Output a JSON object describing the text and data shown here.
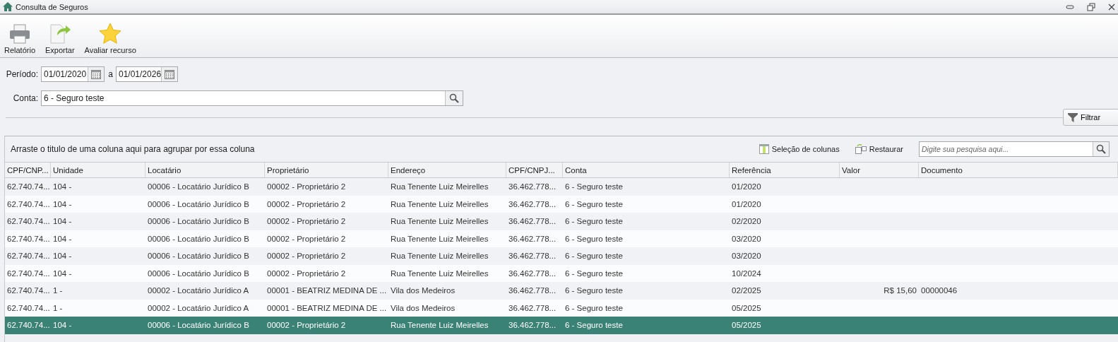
{
  "window": {
    "title": "Consulta de Seguros"
  },
  "toolbar": [
    {
      "label": "Relatório",
      "kind": "printer"
    },
    {
      "label": "Exportar",
      "kind": "export"
    },
    {
      "label": "Avaliar recurso",
      "kind": "star"
    }
  ],
  "filters": {
    "period_label": "Período:",
    "start_date": "01/01/2020",
    "separator": "a",
    "end_date": "01/01/2026",
    "account_label": "Conta:",
    "account": "6 - Seguro teste"
  },
  "filter_button": "Filtrar",
  "grid": {
    "group_hint": "Arraste o titulo de uma coluna aqui para agrupar por essa coluna",
    "column_chooser": "Seleção de colunas",
    "restore": "Restaurar",
    "search": {
      "placeholder": "Digite sua pesquisa aqui..."
    },
    "columns": [
      "CPF/CNP...",
      "Unidade",
      "Locatário",
      "Proprietário",
      "Endereço",
      "CPF/CNPJ...",
      "Conta",
      "Referência",
      "Valor",
      "Documento"
    ],
    "rows": [
      {
        "selected": false,
        "cpf_cnpj": "62.740.74...",
        "unidade": "104 -",
        "locatario": "00006 - Locatário Jurídico B",
        "proprietario": "00002 - Proprietário 2",
        "endereco": "Rua Tenente Luiz Meirelles",
        "cpf_cnpj_proprietario": "36.462.778...",
        "conta": "6 - Seguro teste",
        "referencia": "01/2020"
      },
      {
        "selected": false,
        "cpf_cnpj": "62.740.74...",
        "unidade": "104 -",
        "locatario": "00006 - Locatário Jurídico B",
        "proprietario": "00002 - Proprietário 2",
        "endereco": "Rua Tenente Luiz Meirelles",
        "cpf_cnpj_proprietario": "36.462.778...",
        "conta": "6 - Seguro teste",
        "referencia": "01/2020"
      },
      {
        "selected": false,
        "cpf_cnpj": "62.740.74...",
        "unidade": "104 -",
        "locatario": "00006 - Locatário Jurídico B",
        "proprietario": "00002 - Proprietário 2",
        "endereco": "Rua Tenente Luiz Meirelles",
        "cpf_cnpj_proprietario": "36.462.778...",
        "conta": "6 - Seguro teste",
        "referencia": "02/2020"
      },
      {
        "selected": false,
        "cpf_cnpj": "62.740.74...",
        "unidade": "104 -",
        "locatario": "00006 - Locatário Jurídico B",
        "proprietario": "00002 - Proprietário 2",
        "endereco": "Rua Tenente Luiz Meirelles",
        "cpf_cnpj_proprietario": "36.462.778...",
        "conta": "6 - Seguro teste",
        "referencia": "03/2020"
      },
      {
        "selected": false,
        "cpf_cnpj": "62.740.74...",
        "unidade": "104 -",
        "locatario": "00006 - Locatário Jurídico B",
        "proprietario": "00002 - Proprietário 2",
        "endereco": "Rua Tenente Luiz Meirelles",
        "cpf_cnpj_proprietario": "36.462.778...",
        "conta": "6 - Seguro teste",
        "referencia": "03/2020"
      },
      {
        "selected": false,
        "cpf_cnpj": "62.740.74...",
        "unidade": "104 -",
        "locatario": "00006 - Locatário Jurídico B",
        "proprietario": "00002 - Proprietário 2",
        "endereco": "Rua Tenente Luiz Meirelles",
        "cpf_cnpj_proprietario": "36.462.778...",
        "conta": "6 - Seguro teste",
        "referencia": "10/2024"
      },
      {
        "selected": false,
        "cpf_cnpj": "62.740.74...",
        "unidade": "1 -",
        "locatario": "00002 - Locatário Jurídico A",
        "proprietario": "00001 - BEATRIZ MEDINA DE ...",
        "endereco": "Vila dos Medeiros",
        "cpf_cnpj_proprietario": "36.462.778...",
        "conta": "6 - Seguro teste",
        "referencia": "02/2025",
        "valor": "R$ 15,60",
        "documento": "00000046"
      },
      {
        "selected": false,
        "cpf_cnpj": "62.740.74...",
        "unidade": "1 -",
        "locatario": "00002 - Locatário Jurídico A",
        "proprietario": "00001 - BEATRIZ MEDINA DE ...",
        "endereco": "Vila dos Medeiros",
        "cpf_cnpj_proprietario": "36.462.778...",
        "conta": "6 - Seguro teste",
        "referencia": "05/2025"
      },
      {
        "selected": true,
        "cpf_cnpj": "62.740.74...",
        "unidade": "104 -",
        "locatario": "00006 - Locatário Jurídico B",
        "proprietario": "00002 - Proprietário 2",
        "endereco": "Rua Tenente Luiz Meirelles",
        "cpf_cnpj_proprietario": "36.462.778...",
        "conta": "6 - Seguro teste",
        "referencia": "05/2025"
      }
    ]
  }
}
